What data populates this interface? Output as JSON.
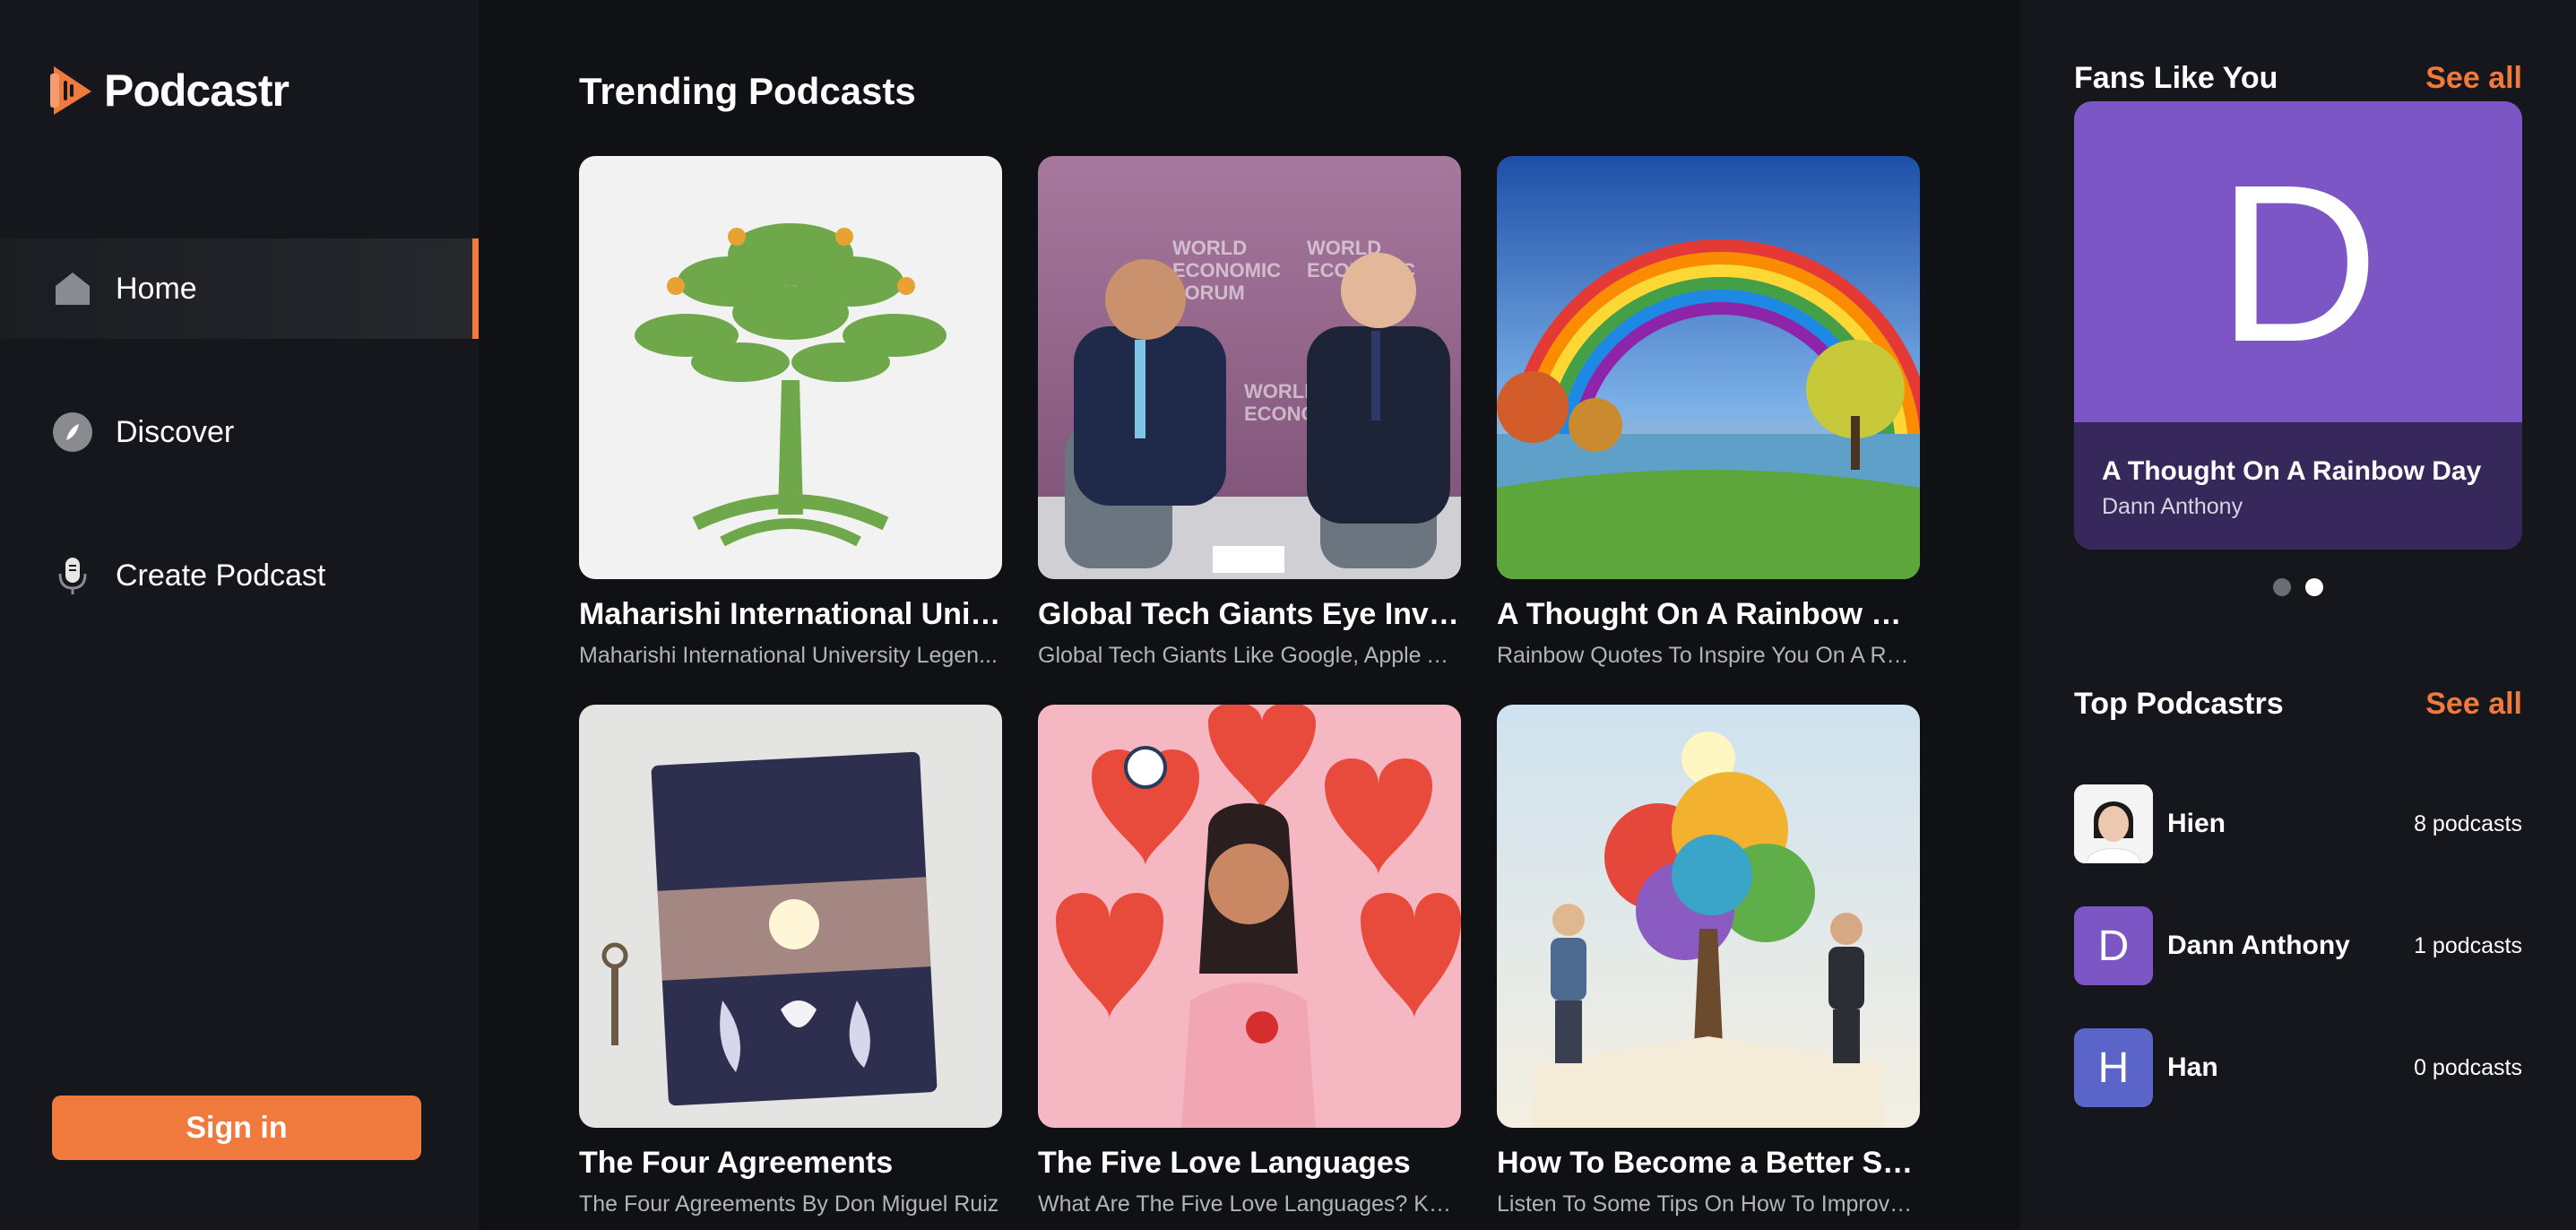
{
  "app": {
    "name": "Podcastr"
  },
  "nav": {
    "items": [
      {
        "label": "Home",
        "icon": "home-icon",
        "active": true
      },
      {
        "label": "Discover",
        "icon": "compass-icon",
        "active": false
      },
      {
        "label": "Create Podcast",
        "icon": "microphone-icon",
        "active": false
      }
    ],
    "signin_label": "Sign in"
  },
  "main": {
    "section_title": "Trending Podcasts",
    "cards": [
      {
        "title": "Maharishi International Univ...",
        "description": "Maharishi International University Legen...",
        "image": "green-tree-logo"
      },
      {
        "title": "Global Tech Giants Eye Inves...",
        "description": "Global Tech Giants Like Google, Apple An...",
        "image": "world-economic-forum-interview"
      },
      {
        "title": "A Thought On A Rainbow Day",
        "description": "Rainbow Quotes To Inspire You On A Rain...",
        "image": "rainbow-landscape"
      },
      {
        "title": "The Four Agreements",
        "description": "The Four Agreements By Don Miguel Ruiz",
        "image": "book-cover"
      },
      {
        "title": "The Five Love Languages",
        "description": "What Are The Five Love Languages? Kno...",
        "image": "love-hearts-illustration"
      },
      {
        "title": "How To Become a Better Soft...",
        "description": "Listen To Some Tips On How To Improve A...",
        "image": "growth-tree-illustration"
      }
    ]
  },
  "fans": {
    "title": "Fans Like You",
    "see_all": "See all",
    "card": {
      "letter": "D",
      "podcast": "A Thought On A Rainbow Day",
      "author": "Dann Anthony",
      "bg_color": "#7b56c4"
    },
    "dots": [
      {
        "active": false
      },
      {
        "active": true
      }
    ]
  },
  "top_podcastrs": {
    "title": "Top Podcastrs",
    "see_all": "See all",
    "items": [
      {
        "name": "Hien",
        "count": "8 podcasts",
        "avatar": "photo"
      },
      {
        "name": "Dann Anthony",
        "count": "1 podcasts",
        "avatar_letter": "D",
        "avatar_color": "#7b56c4"
      },
      {
        "name": "Han",
        "count": "0 podcasts",
        "avatar_letter": "H",
        "avatar_color": "#5b64c9"
      }
    ]
  },
  "colors": {
    "accent": "#f07a3e",
    "sidebar_bg": "#15171c",
    "main_bg": "#101114"
  }
}
